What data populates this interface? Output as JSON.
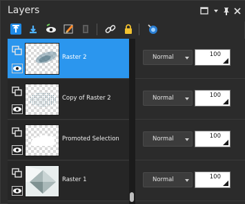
{
  "panel": {
    "title": "Layers"
  },
  "window_controls": [
    {
      "name": "maximize-icon"
    },
    {
      "name": "dropdown-icon"
    },
    {
      "name": "pin-icon"
    },
    {
      "name": "close-icon"
    }
  ],
  "toolbar": {
    "buttons": [
      {
        "name": "move-layer-up-icon"
      },
      {
        "name": "move-layer-down-icon"
      },
      {
        "name": "layer-visibility-icon"
      },
      {
        "name": "brush-edit-icon"
      },
      {
        "name": "delete-layer-icon"
      },
      {
        "name": "link-icon"
      },
      {
        "name": "lock-icon"
      },
      {
        "name": "layer-effects-icon"
      }
    ]
  },
  "layers": [
    {
      "name": "Raster 2",
      "blend_mode": "Normal",
      "opacity": "100",
      "opacity_fraction": 1.0,
      "selected": true,
      "thumb": "blur"
    },
    {
      "name": "Copy of Raster 2",
      "blend_mode": "Normal",
      "opacity": "100",
      "opacity_fraction": 1.0,
      "selected": false,
      "thumb": "dots"
    },
    {
      "name": "Promoted Selection",
      "blend_mode": "Normal",
      "opacity": "100",
      "opacity_fraction": 1.0,
      "selected": false,
      "thumb": "cloud"
    },
    {
      "name": "Raster 1",
      "blend_mode": "Normal",
      "opacity": "100",
      "opacity_fraction": 1.0,
      "selected": false,
      "thumb": "geometric"
    }
  ],
  "colors": {
    "selection": "#2b96ee",
    "panel_bg": "#2b2b2b"
  }
}
